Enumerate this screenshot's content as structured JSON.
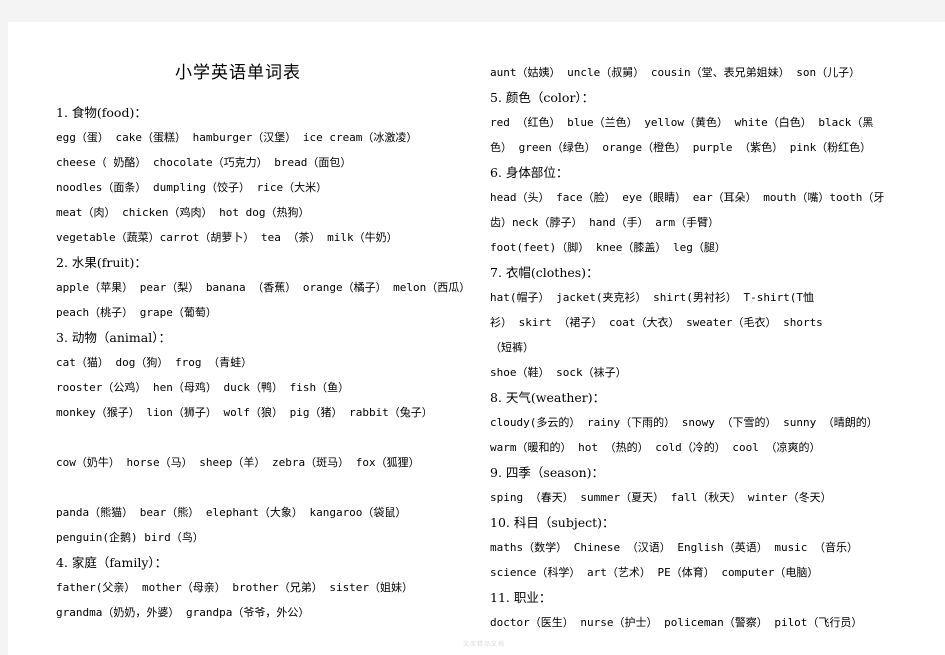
{
  "document": {
    "title": "小学英语单词表",
    "watermark": "文库精品文档"
  },
  "left_column": {
    "sections": [
      {
        "heading": "1. 食物(food)：",
        "lines": [
          "egg（蛋）  cake（蛋糕）   hamburger（汉堡）   ice cream（冰激凌）",
          "cheese（ 奶酪）   chocolate（巧克力）   bread（面包）",
          "noodles（面条）  dumpling（饺子）    rice（大米）",
          "meat（肉）        chicken（鸡肉）       hot dog（热狗）",
          "vegetable（蔬菜）carrot（胡萝卜）       tea （茶）      milk（牛奶）"
        ]
      },
      {
        "heading": "2. 水果(fruit)：",
        "lines": [
          "apple（苹果） pear（梨） banana （香蕉）  orange（橘子） melon（西瓜）",
          "  peach（桃子）    grape（葡萄）"
        ]
      },
      {
        "heading": "3. 动物（animal）：",
        "lines": [
          "cat（猫）         dog（狗）     frog  （青蛙）",
          "rooster（公鸡）  hen（母鸡）  duck（鸭）  fish（鱼）",
          "monkey（猴子） lion（狮子）  wolf（狼）   pig（猪）       rabbit（兔子）",
          "",
          "cow（奶牛）      horse（马）   sheep（羊）  zebra（斑马）  fox（狐狸）",
          "",
          "panda（熊猫）  bear（熊）       elephant（大象）  kangaroo（袋鼠）",
          "penguin(企鹅)   bird（鸟）"
        ]
      },
      {
        "heading": "4. 家庭（family）：",
        "lines": [
          "father(父亲）    mother（母亲）    brother（兄弟）    sister（姐妹）",
          "  grandma（奶奶，外婆）  grandpa（爷爷，外公）"
        ]
      }
    ]
  },
  "right_column": {
    "sections": [
      {
        "heading": "",
        "lines": [
          "aunt（姑姨） uncle（叔舅）   cousin（堂、表兄弟姐妹）  son（儿子）"
        ]
      },
      {
        "heading": "5. 颜色（color）：",
        "lines": [
          "red （红色）    blue（兰色）  yellow（黄色） white（白色）   black（黑",
          "色）    green（绿色）  orange（橙色）  purple （紫色）   pink（粉红色）"
        ]
      },
      {
        "heading": "6. 身体部位：",
        "lines": [
          "head（头）  face（脸）  eye（眼睛）   ear（耳朵）  mouth（嘴）tooth（牙",
          "齿）neck（脖子）    hand（手）   arm（手臂）",
          "foot(feet)（脚）  knee（膝盖）  leg（腿）"
        ]
      },
      {
        "heading": "7. 衣帽(clothes)：",
        "lines": [
          "hat(帽子）        jacket(夹克衫）   shirt(男衬衫）      T-shirt(T恤",
          "衫）  skirt （裙子）  coat（大衣）        sweater（毛衣）     shorts",
          "（短裤）",
          "shoe（鞋）    sock（袜子）"
        ]
      },
      {
        "heading": "8. 天气(weather)：",
        "lines": [
          "cloudy(多云的）  rainy（下雨的）   snowy （下雪的）  sunny （晴朗的）",
          "warm（暖和的） hot （热的）     cold（冷的）      cool （凉爽的）"
        ]
      },
      {
        "heading": "9. 四季（season)：",
        "lines": [
          "sping （春天）   summer（夏天）   fall（秋天）      winter（冬天）"
        ]
      },
      {
        "heading": "10. 科目（subject)：",
        "lines": [
          "maths（数学）   Chinese （汉语） English（英语）   music （音乐）",
          "science（科学）  art（艺术）      PE（体育）     computer（电脑）"
        ]
      },
      {
        "heading": "11. 职业：",
        "lines": [
          "doctor（医生）  nurse（护士）  policeman（警察）    pilot（飞行员）"
        ]
      }
    ]
  }
}
